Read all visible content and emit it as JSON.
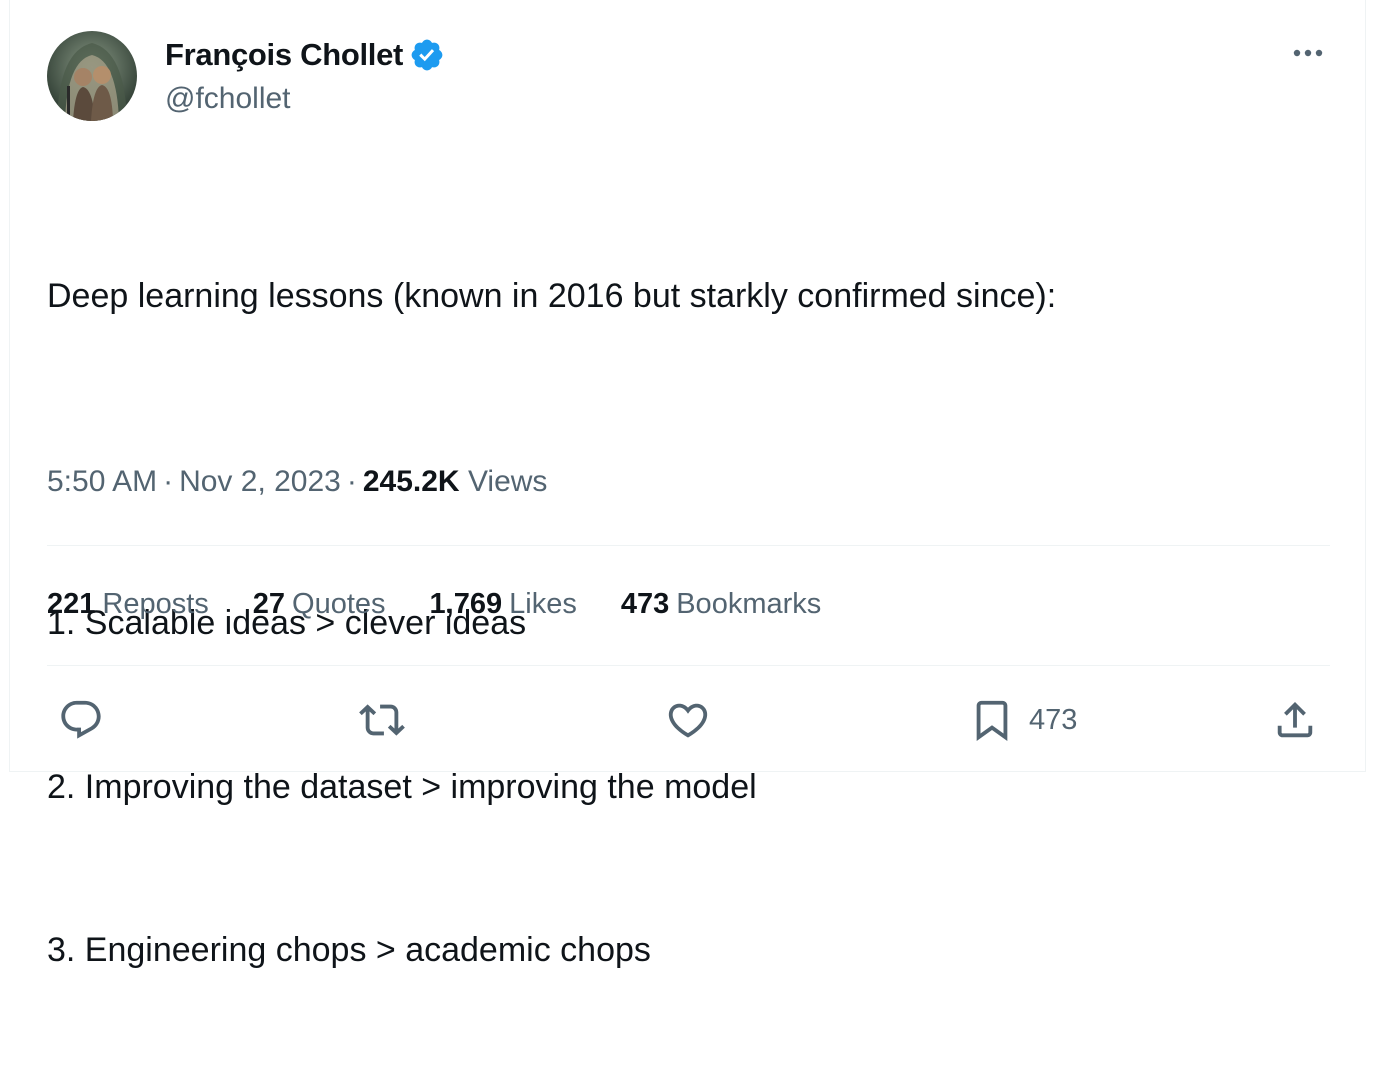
{
  "author": {
    "display_name": "François Chollet",
    "handle": "@fchollet",
    "verified": true
  },
  "tweet": {
    "lines": [
      "Deep learning lessons (known in 2016 but starkly confirmed since):",
      "",
      "1. Scalable ideas > clever ideas",
      "2. Improving the dataset > improving the model",
      "3. Engineering chops > academic chops"
    ],
    "time": "5:50 AM",
    "date": "Nov 2, 2023",
    "separator": "·",
    "views_count": "245.2K",
    "views_label": "Views"
  },
  "stats": {
    "reposts": {
      "count": "221",
      "label": "Reposts"
    },
    "quotes": {
      "count": "27",
      "label": "Quotes"
    },
    "likes": {
      "count": "1,769",
      "label": "Likes"
    },
    "bookmarks": {
      "count": "473",
      "label": "Bookmarks"
    }
  },
  "actions": {
    "reply_icon": "reply-icon",
    "repost_icon": "repost-icon",
    "like_icon": "heart-icon",
    "bookmark_icon": "bookmark-icon",
    "bookmark_count": "473",
    "share_icon": "share-icon"
  },
  "colors": {
    "verified_badge": "#1d9bf0",
    "text_primary": "#0f1419",
    "text_secondary": "#536471",
    "divider": "#eff3f4"
  }
}
